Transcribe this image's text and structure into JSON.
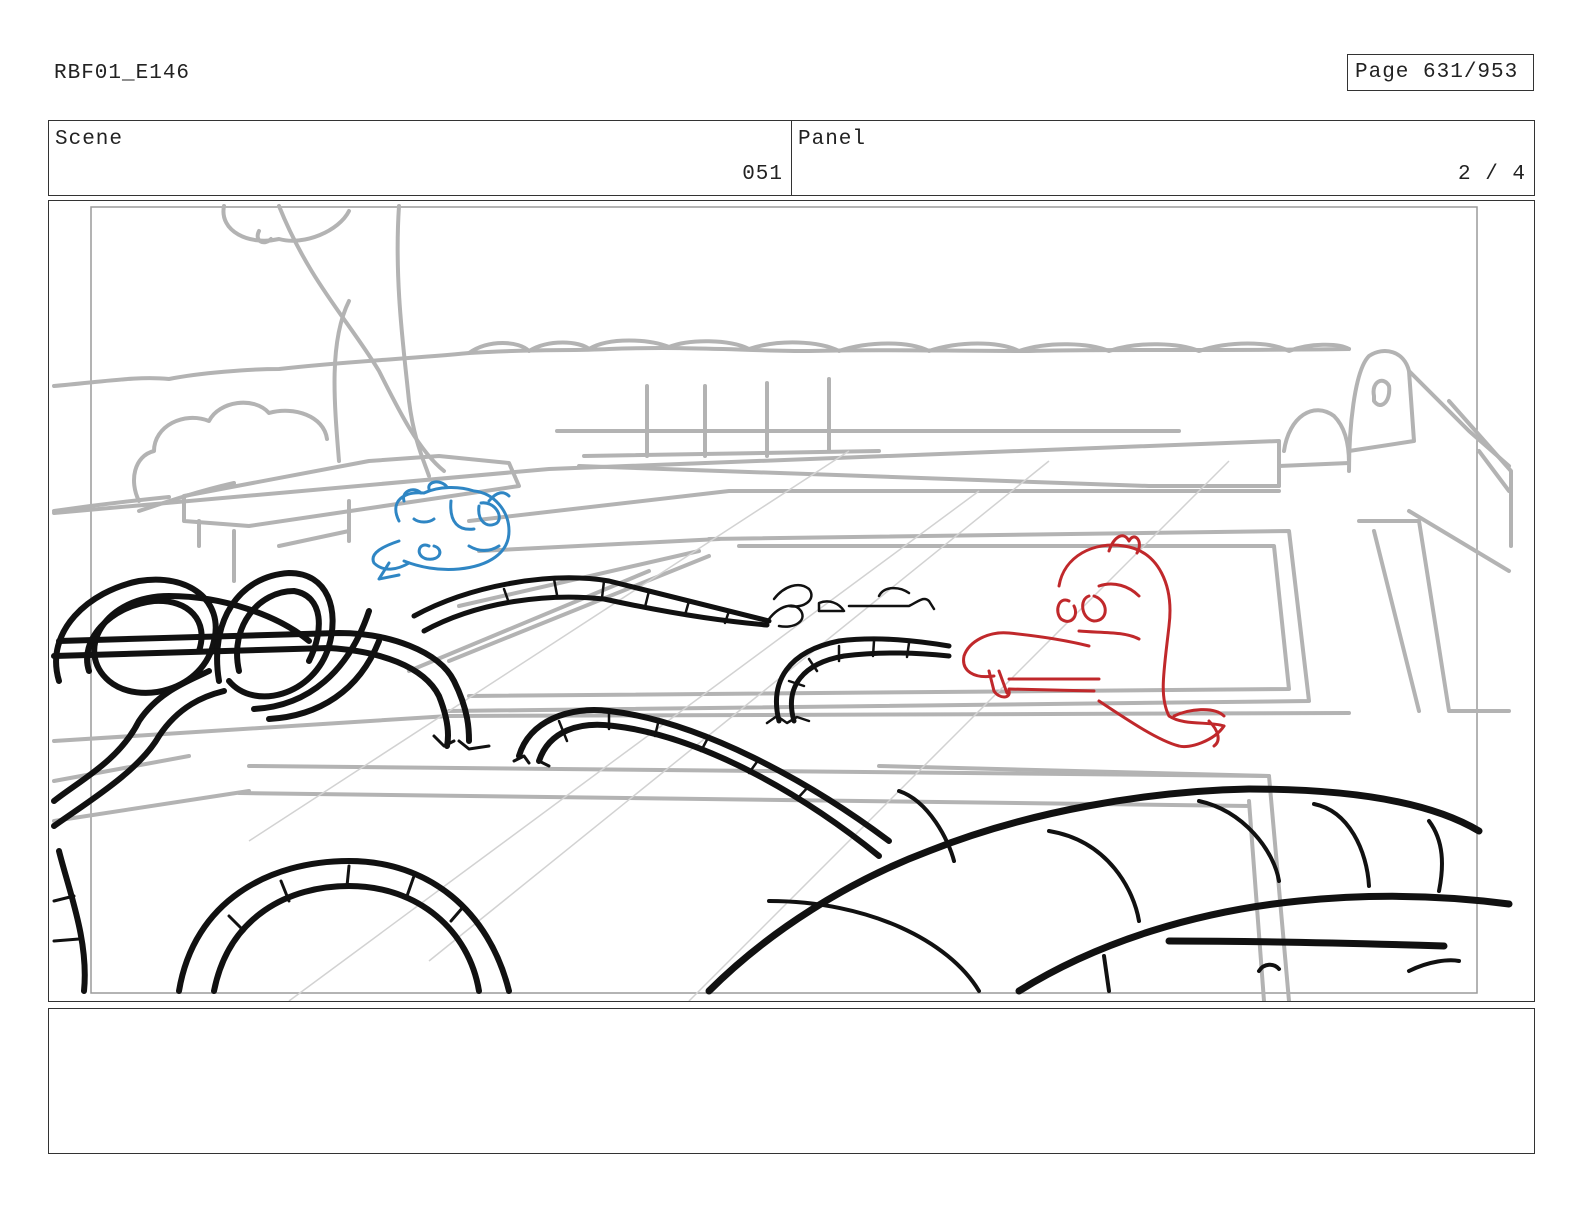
{
  "header": {
    "doc_id": "RBF01_E146",
    "page": "Page 631/953"
  },
  "scene": {
    "label": "Scene",
    "value": "051"
  },
  "panel": {
    "label": "Panel",
    "value": "2 / 4"
  },
  "notes": {
    "text": ""
  },
  "drawing": {
    "line_colors": {
      "background": "#b3b3b3",
      "ink": "#111111",
      "blue_character": "#2f86c4",
      "red_character": "#c0282b"
    }
  }
}
